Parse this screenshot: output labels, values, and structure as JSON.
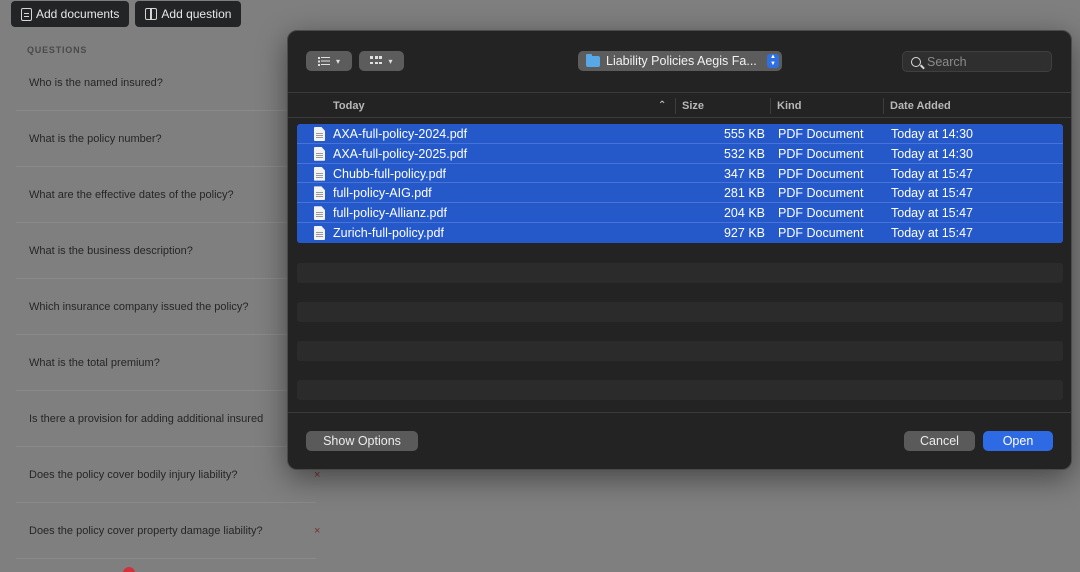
{
  "toolbar": {
    "add_documents": "Add documents",
    "add_question": "Add question"
  },
  "questions": {
    "heading": "QUESTIONS",
    "items": [
      {
        "text": "Who is the named insured?",
        "remove": ""
      },
      {
        "text": "What is the policy number?",
        "remove": ""
      },
      {
        "text": "What are the effective dates of the policy?",
        "remove": ""
      },
      {
        "text": "What is the business description?",
        "remove": ""
      },
      {
        "text": "Which insurance company issued the policy?",
        "remove": ""
      },
      {
        "text": "What is the total premium?",
        "remove": ""
      },
      {
        "text": "Is there a provision for adding additional insured",
        "remove": ""
      },
      {
        "text": "Does the policy cover bodily injury liability?",
        "remove": "×"
      },
      {
        "text": "Does the policy cover property damage liability?",
        "remove": "×"
      }
    ]
  },
  "dialog": {
    "location": "Liability Policies Aegis Fa...",
    "search_placeholder": "Search",
    "columns": {
      "name": "Today",
      "size": "Size",
      "kind": "Kind",
      "date": "Date Added"
    },
    "files": [
      {
        "name": "AXA-full-policy-2024.pdf",
        "size": "555 KB",
        "kind": "PDF Document",
        "date": "Today at 14:30",
        "selected": true
      },
      {
        "name": "AXA-full-policy-2025.pdf",
        "size": "532 KB",
        "kind": "PDF Document",
        "date": "Today at 14:30",
        "selected": true
      },
      {
        "name": "Chubb-full-policy.pdf",
        "size": "347 KB",
        "kind": "PDF Document",
        "date": "Today at 15:47",
        "selected": true
      },
      {
        "name": "full-policy-AIG.pdf",
        "size": "281 KB",
        "kind": "PDF Document",
        "date": "Today at 15:47",
        "selected": true
      },
      {
        "name": "full-policy-Allianz.pdf",
        "size": "204 KB",
        "kind": "PDF Document",
        "date": "Today at 15:47",
        "selected": true
      },
      {
        "name": "Zurich-full-policy.pdf",
        "size": "927 KB",
        "kind": "PDF Document",
        "date": "Today at 15:47",
        "selected": true
      }
    ],
    "buttons": {
      "show_options": "Show Options",
      "cancel": "Cancel",
      "open": "Open"
    }
  },
  "colors": {
    "selection": "#2559c9",
    "primary_button": "#2d6ae3",
    "folder": "#58a7e6"
  }
}
